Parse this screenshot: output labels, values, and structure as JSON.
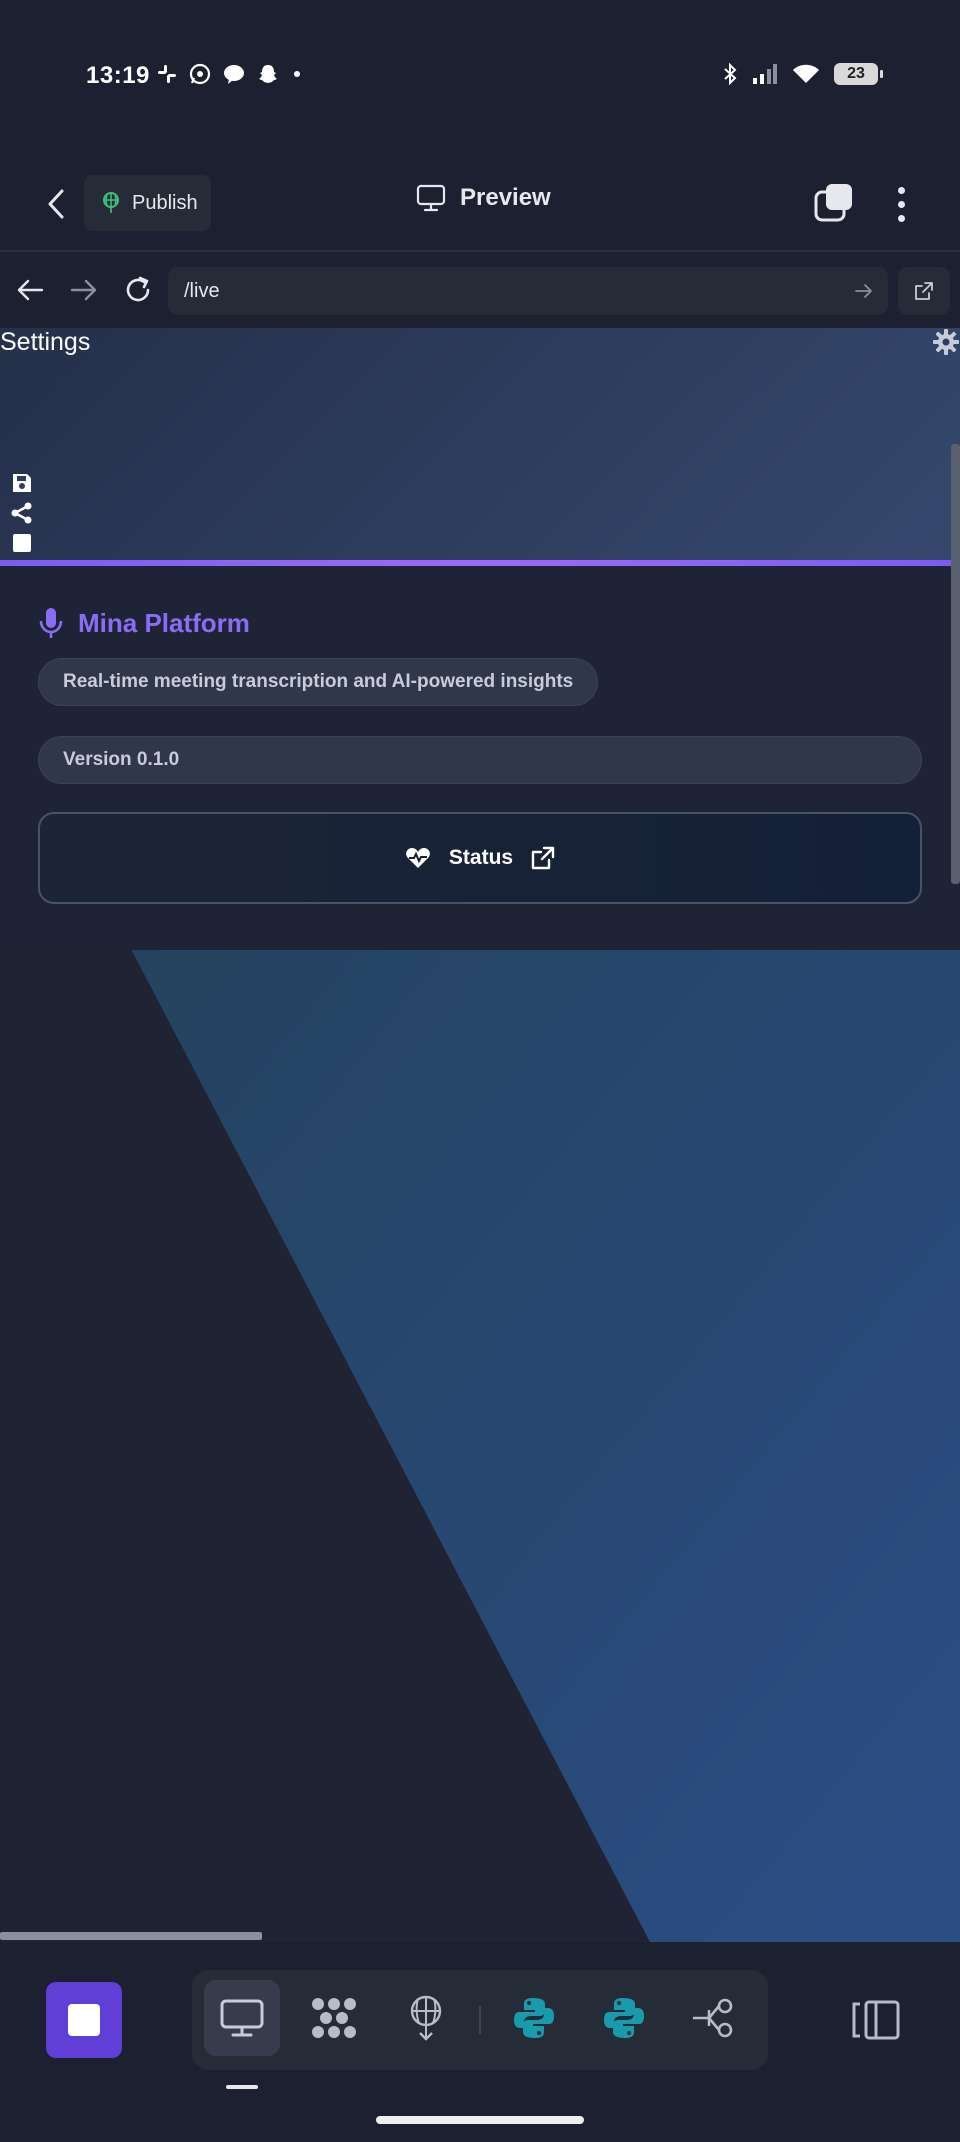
{
  "status_bar": {
    "time": "13:19",
    "left_icons": [
      "slack-icon",
      "whatsapp-icon",
      "messenger-icon",
      "snapchat-icon",
      "dot-icon"
    ],
    "right_icons": [
      "bluetooth-icon",
      "signal-icon",
      "wifi-icon"
    ],
    "battery": "23"
  },
  "app_bar": {
    "publish_label": "Publish",
    "preview_label": "Preview"
  },
  "url_bar": {
    "url": "/live"
  },
  "page": {
    "settings_title": "Settings",
    "brand_name": "Mina Platform",
    "tagline": "Real-time meeting transcription and AI-powered insights",
    "version": "Version 0.1.0",
    "status_button": "Status"
  },
  "colors": {
    "accent": "#7b5cf0",
    "brand_text": "#8b6cf6",
    "stop_button": "#5f3fd6",
    "python_teal": "#1a9aad",
    "publish_icon": "#3fbf78"
  },
  "bottom_toolbar": {
    "tools": [
      "desktop-icon",
      "nodes-icon",
      "deploy-icon",
      "python-icon",
      "python-icon",
      "workflow-icon"
    ],
    "active_tool": "desktop-icon"
  }
}
